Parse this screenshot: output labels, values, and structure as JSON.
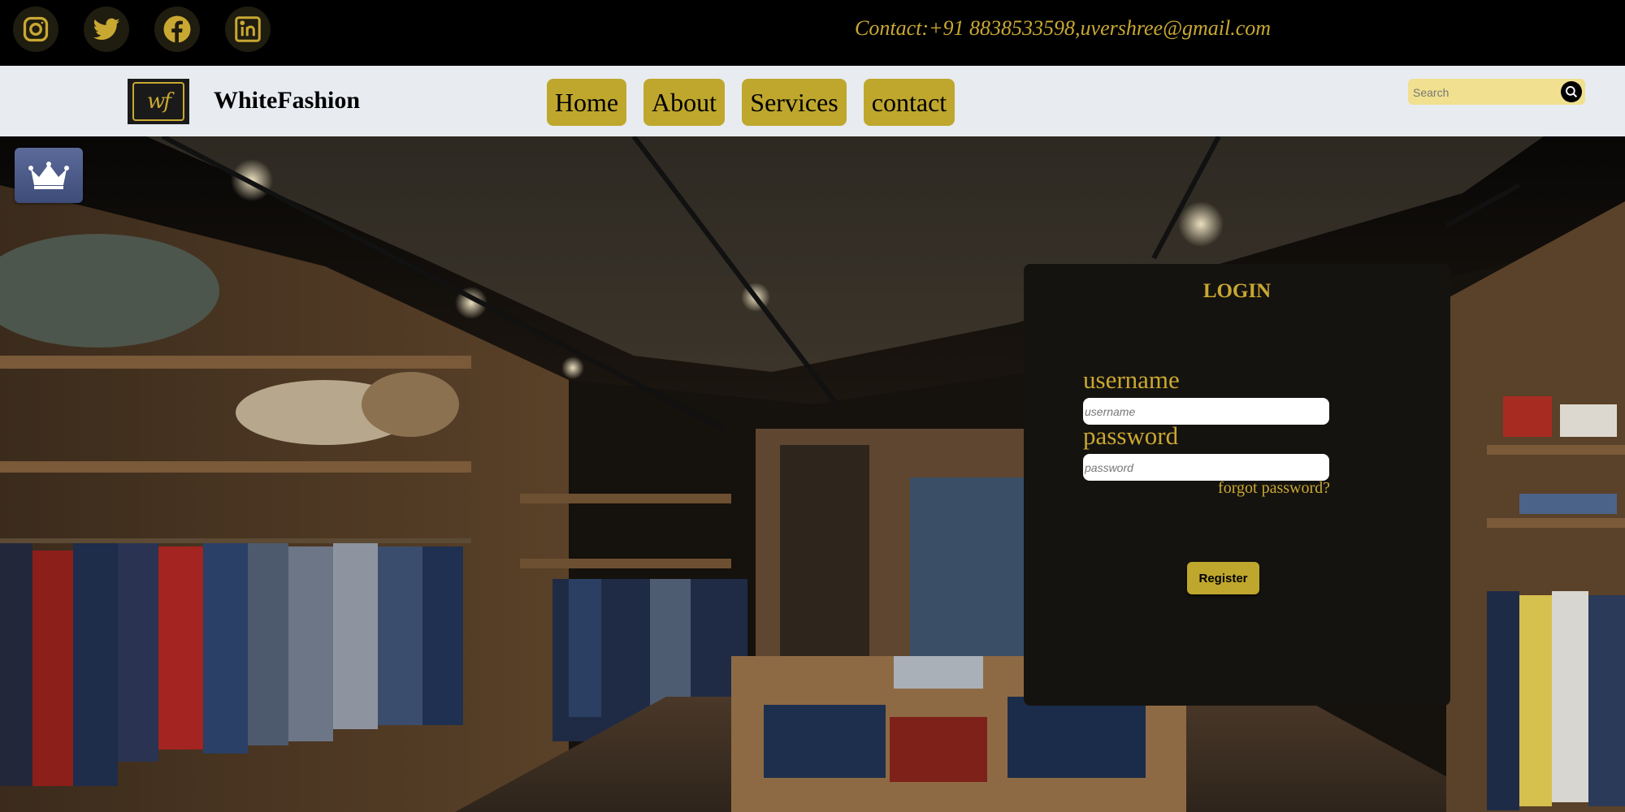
{
  "social": {
    "icons": [
      "instagram-icon",
      "twitter-icon",
      "facebook-icon",
      "linkedin-icon"
    ],
    "contact_text": "Contact:+91 8838533598,uvershree@gmail.com"
  },
  "header": {
    "logo_text": "wf",
    "brand": "WhiteFashion",
    "nav": [
      {
        "label": "Home"
      },
      {
        "label": "About"
      },
      {
        "label": "Services"
      },
      {
        "label": "contact"
      }
    ],
    "search": {
      "placeholder": "Search"
    }
  },
  "hero": {
    "crown_icon": "crown-icon"
  },
  "login": {
    "title": "LOGIN",
    "username_label": "username",
    "username_placeholder": "username",
    "password_label": "password",
    "password_placeholder": "password",
    "forgot": "forgot password?",
    "register": "Register"
  },
  "colors": {
    "accent_gold": "#bfa72e",
    "text_gold": "#c9a832",
    "nav_bg": "#e8ecf0",
    "card_bg": "#15130f"
  }
}
